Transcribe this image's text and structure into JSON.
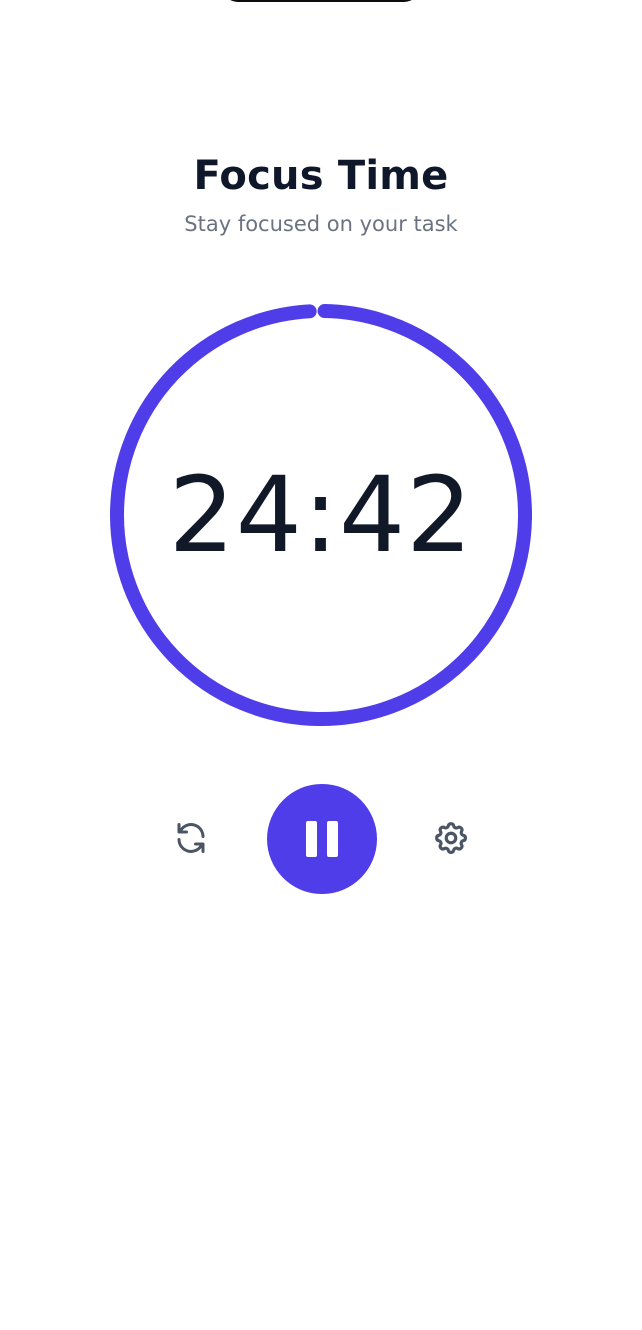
{
  "header": {
    "title": "Focus Time",
    "subtitle": "Stay focused on your task"
  },
  "timer": {
    "remaining": "24:42",
    "progress_remaining_fraction": 0.988,
    "accent_color": "#4f3dea"
  },
  "controls": {
    "reset": {
      "icon": "refresh-icon"
    },
    "pause": {
      "icon": "pause-icon",
      "color": "#4f3dea"
    },
    "settings": {
      "icon": "gear-icon"
    }
  },
  "colors": {
    "title": "#0f172a",
    "subtitle": "#6b7280",
    "icon": "#4b5563"
  }
}
